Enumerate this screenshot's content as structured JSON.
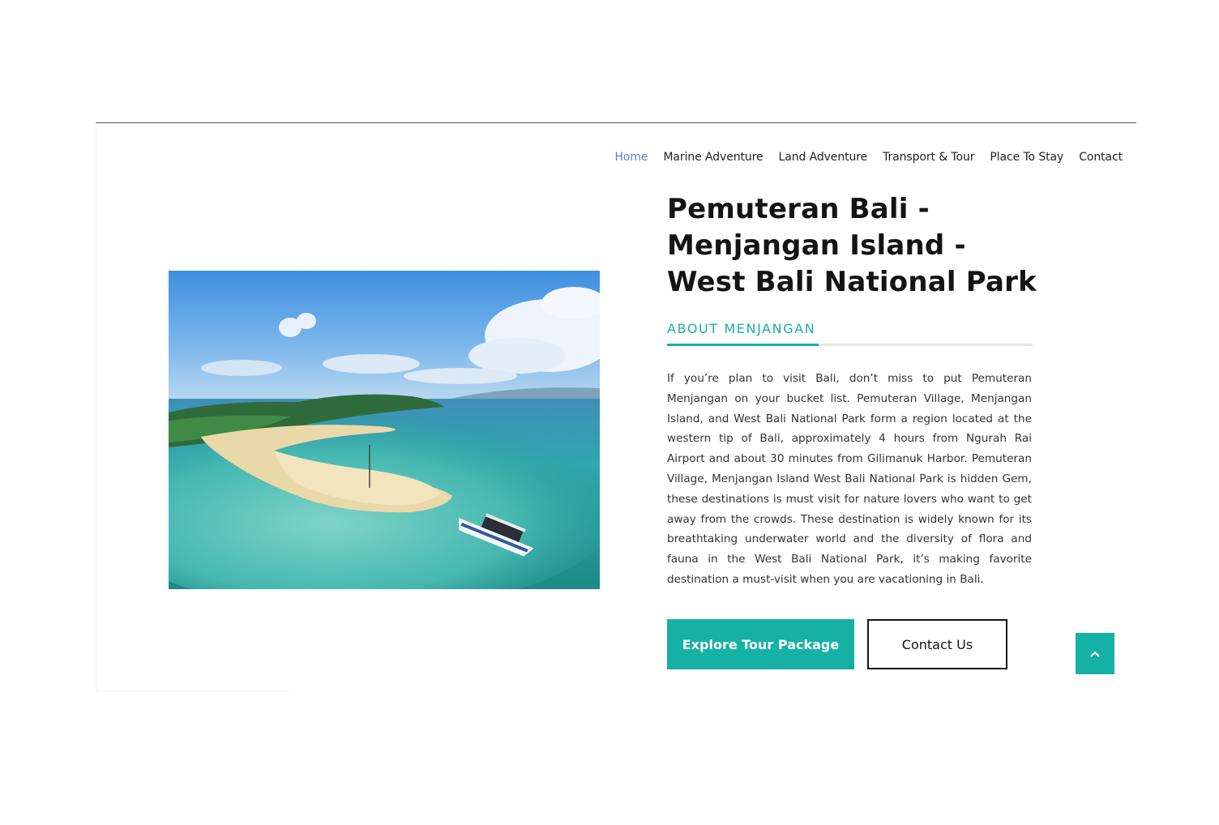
{
  "nav": {
    "items": [
      {
        "label": "Home",
        "active": true
      },
      {
        "label": "Marine Adventure",
        "active": false
      },
      {
        "label": "Land Adventure",
        "active": false
      },
      {
        "label": "Transport & Tour",
        "active": false
      },
      {
        "label": "Place To Stay",
        "active": false
      },
      {
        "label": "Contact",
        "active": false
      }
    ]
  },
  "hero": {
    "title": "Pemuteran Bali - Menjangan Island - West Bali National Park",
    "section_label": "ABOUT MENJANGAN",
    "description": "If you’re plan to visit Bali, don’t miss to put Pemuteran Menjangan on your bucket list. Pemuteran Village, Menjangan Island, and West Bali National Park form a region located at the western tip of Bali, approximately 4 hours from Ngurah Rai Airport and about 30 minutes from Gilimanuk Harbor. Pemuteran Village, Menjangan Island West Bali National Park is hidden Gem, these destinations is must visit for nature lovers who want to get away from the crowds. These destination is widely known for its breathtaking underwater world and the diversity of flora and fauna in the West Bali National Park, it’s making favorite destination a must-visit when you are vacationing in Bali."
  },
  "buttons": {
    "primary": "Explore Tour Package",
    "secondary": "Contact Us"
  },
  "icons": {
    "back_to_top": "chevron-up-icon"
  },
  "colors": {
    "accent": "#16b1a5",
    "nav_active": "#5b7fd6",
    "heading": "#141414"
  }
}
